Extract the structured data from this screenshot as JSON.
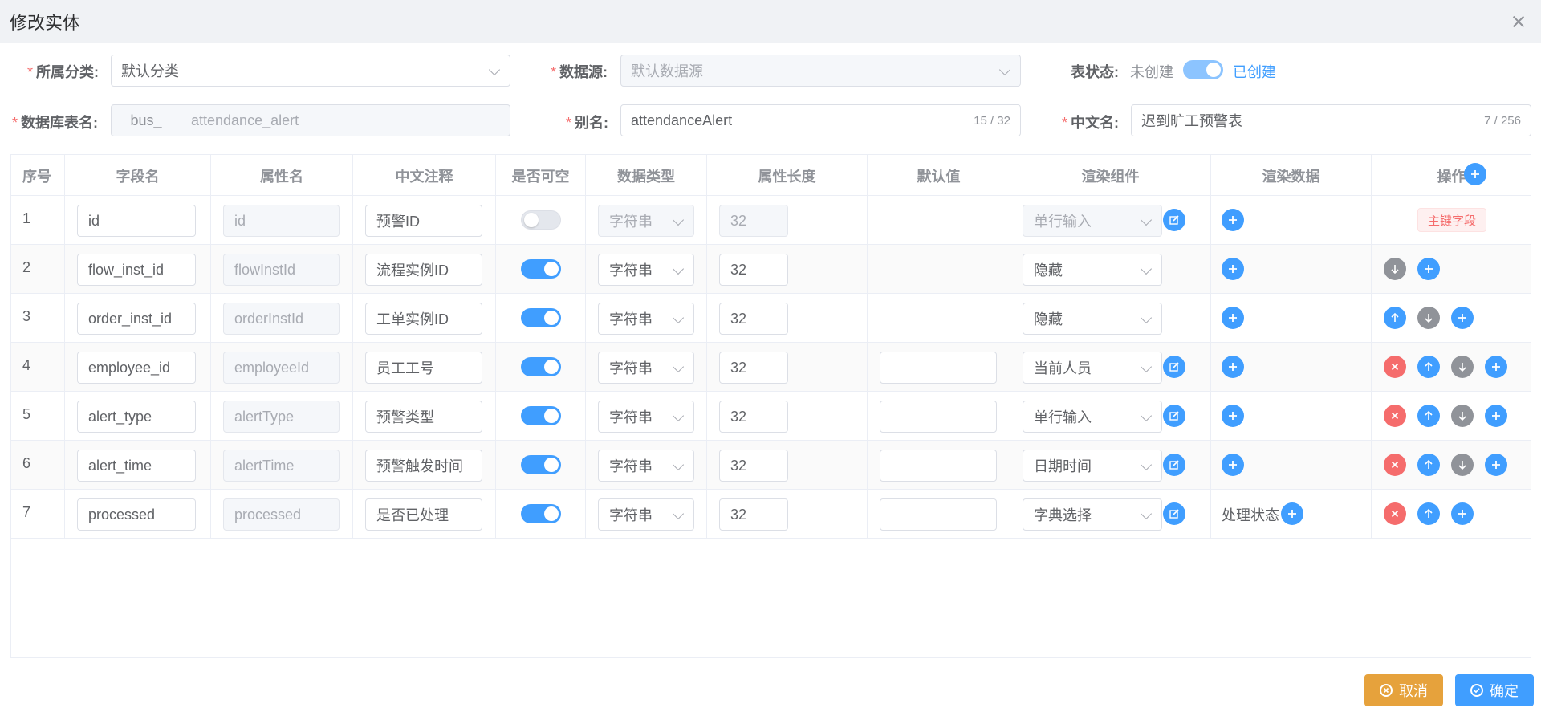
{
  "dialog": {
    "title": "修改实体"
  },
  "form": {
    "category_label": "所属分类:",
    "category_value": "默认分类",
    "datasource_label": "数据源:",
    "datasource_value": "默认数据源",
    "table_status_label": "表状态:",
    "status_off_text": "未创建",
    "status_on_text": "已创建",
    "db_table_label": "数据库表名:",
    "db_prefix": "bus_",
    "db_table_value": "attendance_alert",
    "alias_label": "别名:",
    "alias_value": "attendanceAlert",
    "alias_counter": "15 / 32",
    "cn_name_label": "中文名:",
    "cn_name_value": "迟到旷工预警表",
    "cn_name_counter": "7 / 256",
    "required_mark": "*"
  },
  "table": {
    "headers": [
      "序号",
      "字段名",
      "属性名",
      "中文注释",
      "是否可空",
      "数据类型",
      "属性长度",
      "默认值",
      "渲染组件",
      "渲染数据",
      "操作"
    ],
    "rows": [
      {
        "index": "1",
        "field": "id",
        "prop": "id",
        "comment": "预警ID",
        "nullable": false,
        "type": "字符串",
        "length": "32",
        "default": null,
        "render": "单行输入",
        "render_data": "",
        "pk_tag": "主键字段"
      },
      {
        "index": "2",
        "field": "flow_inst_id",
        "prop": "flowInstId",
        "comment": "流程实例ID",
        "nullable": true,
        "type": "字符串",
        "length": "32",
        "default": null,
        "render": "隐藏",
        "render_data": ""
      },
      {
        "index": "3",
        "field": "order_inst_id",
        "prop": "orderInstId",
        "comment": "工单实例ID",
        "nullable": true,
        "type": "字符串",
        "length": "32",
        "default": null,
        "render": "隐藏",
        "render_data": ""
      },
      {
        "index": "4",
        "field": "employee_id",
        "prop": "employeeId",
        "comment": "员工工号",
        "nullable": true,
        "type": "字符串",
        "length": "32",
        "default": "",
        "render": "当前人员",
        "render_data": ""
      },
      {
        "index": "5",
        "field": "alert_type",
        "prop": "alertType",
        "comment": "预警类型",
        "nullable": true,
        "type": "字符串",
        "length": "32",
        "default": "",
        "render": "单行输入",
        "render_data": ""
      },
      {
        "index": "6",
        "field": "alert_time",
        "prop": "alertTime",
        "comment": "预警触发时间",
        "nullable": true,
        "type": "字符串",
        "length": "32",
        "default": "",
        "render": "日期时间",
        "render_data": ""
      },
      {
        "index": "7",
        "field": "processed",
        "prop": "processed",
        "comment": "是否已处理",
        "nullable": true,
        "type": "字符串",
        "length": "32",
        "default": "",
        "render": "字典选择",
        "render_data": "处理状态"
      }
    ]
  },
  "footer": {
    "cancel_label": "取消",
    "confirm_label": "确定"
  },
  "colors": {
    "primary": "#409eff",
    "warning": "#e6a23c",
    "danger": "#f56c6c",
    "info": "#909399"
  }
}
